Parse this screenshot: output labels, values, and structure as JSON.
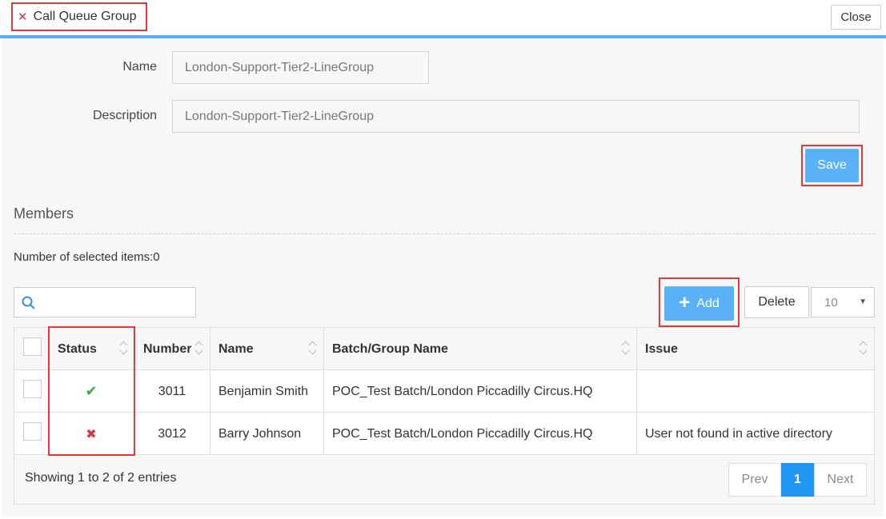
{
  "header": {
    "title": "Call Queue Group",
    "close_label": "Close"
  },
  "form": {
    "name_label": "Name",
    "name_value": "London-Support-Tier2-LineGroup",
    "description_label": "Description",
    "description_value": "London-Support-Tier2-LineGroup",
    "save_label": "Save"
  },
  "members": {
    "heading": "Members",
    "selected_count_text": "Number of selected items:0",
    "add_label": "Add",
    "delete_label": "Delete",
    "page_size": "10",
    "columns": [
      "Status",
      "Number",
      "Name",
      "Batch/Group Name",
      "Issue"
    ],
    "rows": [
      {
        "status": "check-icon",
        "number": "3011",
        "name": "Benjamin Smith",
        "batch": "POC_Test Batch/London Piccadilly Circus.HQ",
        "issue": ""
      },
      {
        "status": "cross-icon",
        "number": "3012",
        "name": "Barry Johnson",
        "batch": "POC_Test Batch/London Piccadilly Circus.HQ",
        "issue": "User not found in active directory"
      }
    ],
    "showing_text": "Showing 1 to 2 of 2 entries",
    "pager": {
      "prev": "Prev",
      "current": "1",
      "next": "Next"
    }
  },
  "colors": {
    "accent": "#5bb1f7",
    "highlight_frame": "#e03a3a",
    "success": "#3faa3f",
    "error": "#d9363e"
  }
}
